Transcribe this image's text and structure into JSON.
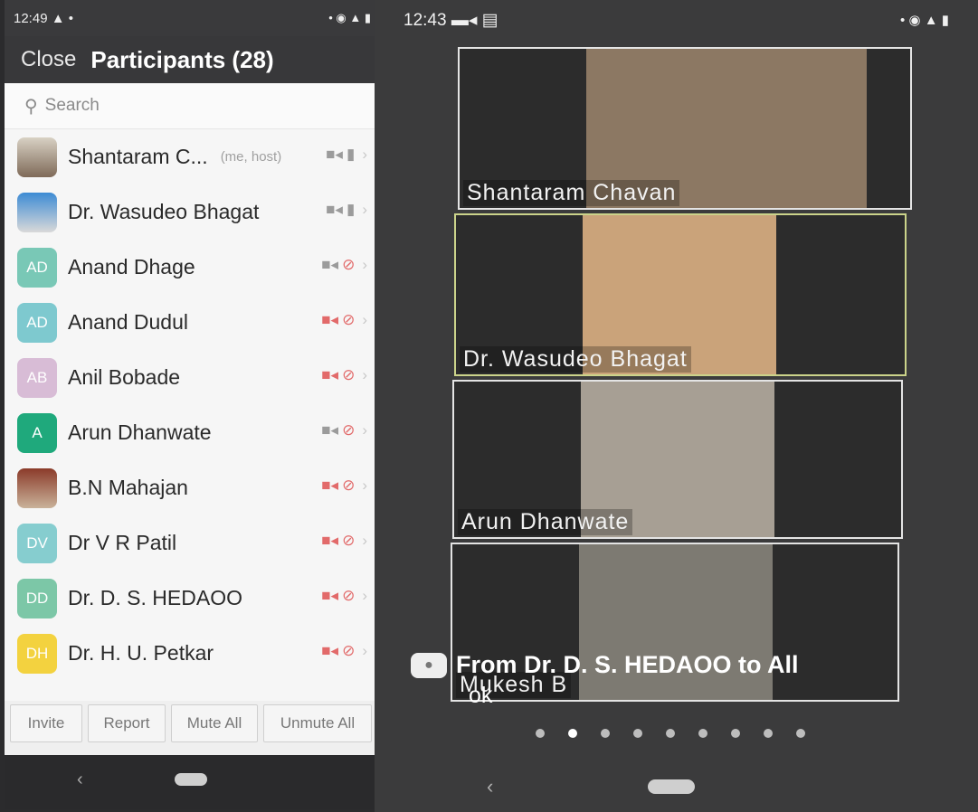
{
  "left_status": {
    "time": "12:49 ▲ •",
    "icons": "• ◉ ▲ ▮"
  },
  "header": {
    "close_label": "Close",
    "title": "Participants (28)"
  },
  "search": {
    "placeholder": "Search"
  },
  "participants": [
    {
      "name": "Shantaram C...",
      "tag": "(me, host)",
      "avatar": "",
      "avatar_kind": "photo",
      "camera": "on",
      "mic": "on"
    },
    {
      "name": "Dr. Wasudeo Bhagat",
      "tag": "",
      "avatar": "",
      "avatar_kind": "photo2",
      "camera": "on",
      "mic": "on"
    },
    {
      "name": "Anand Dhage",
      "tag": "",
      "avatar": "AD",
      "avatar_color": "#79c8b6",
      "camera": "on",
      "mic": "muted"
    },
    {
      "name": "Anand Dudul",
      "tag": "",
      "avatar": "AD",
      "avatar_color": "#7ec9cf",
      "camera": "muted",
      "mic": "muted"
    },
    {
      "name": "Anil Bobade",
      "tag": "",
      "avatar": "AB",
      "avatar_color": "#d8bcd6",
      "camera": "muted",
      "mic": "muted"
    },
    {
      "name": "Arun Dhanwate",
      "tag": "",
      "avatar": "A",
      "avatar_color": "#1fa97c",
      "camera": "on",
      "mic": "muted"
    },
    {
      "name": "B.N Mahajan",
      "tag": "",
      "avatar": "",
      "avatar_kind": "photo3",
      "camera": "muted",
      "mic": "muted"
    },
    {
      "name": "Dr V R Patil",
      "tag": "",
      "avatar": "DV",
      "avatar_color": "#86cdcf",
      "camera": "muted",
      "mic": "muted"
    },
    {
      "name": "Dr. D. S. HEDAOO",
      "tag": "",
      "avatar": "DD",
      "avatar_color": "#7cc7a7",
      "camera": "muted",
      "mic": "muted"
    },
    {
      "name": "Dr. H. U. Petkar",
      "tag": "",
      "avatar": "DH",
      "avatar_color": "#f3d23f",
      "camera": "muted",
      "mic": "muted"
    }
  ],
  "footer": {
    "invite": "Invite",
    "report": "Report",
    "mute_all": "Mute All",
    "unmute_all": "Unmute All"
  },
  "right_status": {
    "time": "12:43 ▬◂ ▤",
    "icons": "• ◉ ▲ ▮"
  },
  "tiles": [
    {
      "label": "Shantaram Chavan",
      "active": false,
      "bg": "#8c7863"
    },
    {
      "label": "Dr. Wasudeo Bhagat",
      "active": true,
      "bg": "#caa37a"
    },
    {
      "label": "Arun Dhanwate",
      "active": false,
      "bg": "#a79f94"
    },
    {
      "label": "Mukesh B",
      "active": false,
      "bg": "#7d7a72"
    }
  ],
  "chat": {
    "from": "From Dr. D. S. HEDAOO to All",
    "message": "ok"
  },
  "pager": {
    "count": 9,
    "active_index": 1
  }
}
